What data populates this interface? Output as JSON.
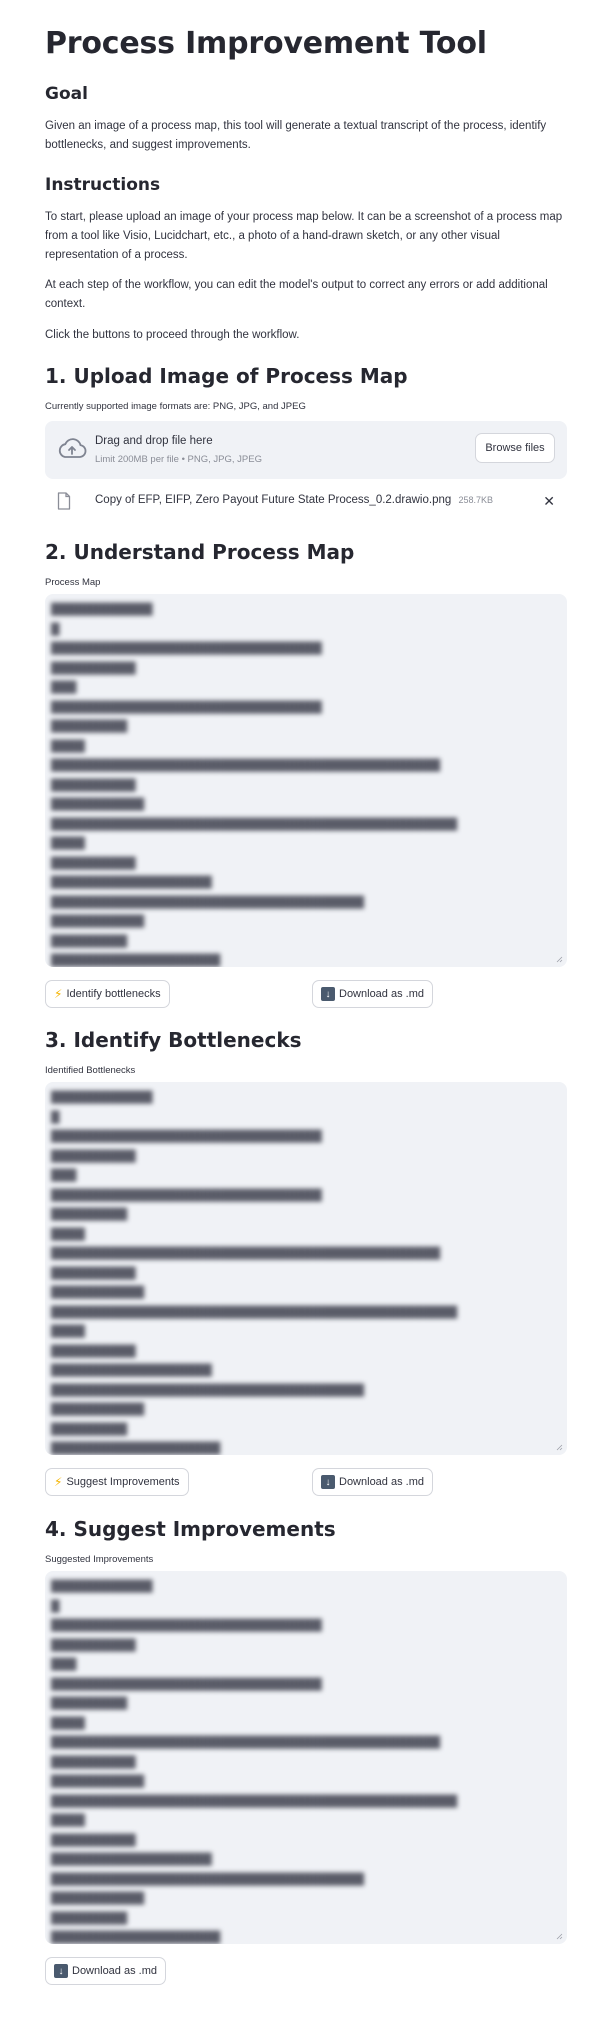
{
  "app": {
    "title": "Process Improvement Tool"
  },
  "goal": {
    "heading": "Goal",
    "text": "Given an image of a process map, this tool will generate a textual transcript of the process, identify bottlenecks, and suggest improvements."
  },
  "instructions": {
    "heading": "Instructions",
    "p1": "To start, please upload an image of your process map below. It can be a screenshot of a process map from a tool like Visio, Lucidchart, etc., a photo of a hand-drawn sketch, or any other visual representation of a process.",
    "p2": "At each step of the workflow, you can edit the model's output to correct any errors or add additional context.",
    "p3": "Click the buttons to proceed through the workflow."
  },
  "upload": {
    "heading": "1. Upload Image of Process Map",
    "formats_label": "Currently supported image formats are: PNG, JPG, and JPEG",
    "drop_title": "Drag and drop file here",
    "drop_sub": "Limit 200MB per file • PNG, JPG, JPEG",
    "browse_label": "Browse files",
    "file": {
      "name": "Copy of EFP, EIFP, Zero Payout Future State Process_0.2.drawio.png",
      "size": "258.7KB"
    }
  },
  "understand": {
    "heading": "2. Understand Process Map",
    "field_label": "Process Map",
    "button_label": "Identify bottlenecks",
    "download_label": "Download as .md"
  },
  "bottlenecks": {
    "heading": "3. Identify Bottlenecks",
    "field_label": "Identified Bottlenecks",
    "button_label": "Suggest Improvements",
    "download_label": "Download as .md"
  },
  "improvements": {
    "heading": "4. Suggest Improvements",
    "field_label": "Suggested Improvements",
    "download_label": "Download as .md"
  },
  "icons": {
    "upload": "cloud-upload-icon",
    "file": "file-icon",
    "close": "close-icon",
    "bolt": "lightning-icon",
    "download": "download-icon"
  }
}
